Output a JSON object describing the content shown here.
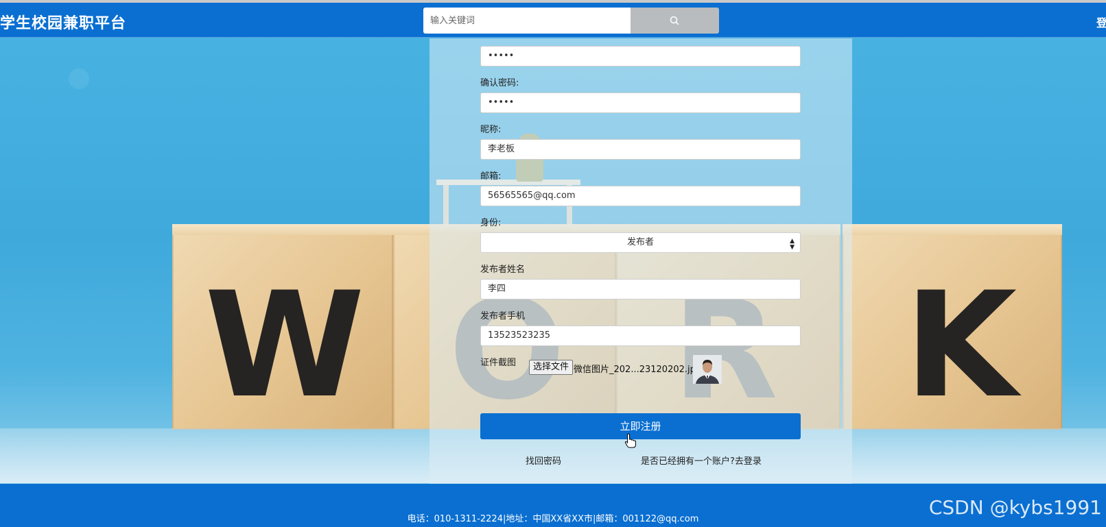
{
  "header": {
    "brand": "学生校园兼职平台",
    "search_placeholder": "输入关键词",
    "login_label": "登录"
  },
  "form": {
    "password_value": "•••••",
    "confirm_password": {
      "label": "确认密码:",
      "value": "•••••"
    },
    "nickname": {
      "label": "昵称:",
      "value": "李老板"
    },
    "email": {
      "label": "邮箱:",
      "value": "56565565@qq.com"
    },
    "role": {
      "label": "身份:",
      "value": "发布者"
    },
    "publisher_name": {
      "label": "发布者姓名",
      "value": "李四"
    },
    "publisher_phone": {
      "label": "发布者手机",
      "value": "13523523235"
    },
    "certificate": {
      "label": "证件截图",
      "choose_file_label": "选择文件",
      "file_name": "微信图片_202...23120202.jpg"
    },
    "submit_label": "立即注册",
    "forgot_password_link": "找回密码",
    "login_prompt_link": "是否已经拥有一个账户?去登录"
  },
  "footer": {
    "contact": "电话：010-1311-2224|地址：中国XX省XX市|邮箱：001122@qq.com"
  },
  "watermark": "CSDN @kybs1991",
  "background": {
    "block_letters": [
      "W",
      "O",
      "R",
      "K"
    ]
  },
  "colors": {
    "primary": "#0a6fd1",
    "search_button": "#b9bcbf",
    "background_sky": "#3fa9dc"
  },
  "icons": {
    "search": "search-icon",
    "select_arrows": "updown-arrows-icon",
    "cursor": "hand-cursor-icon"
  }
}
